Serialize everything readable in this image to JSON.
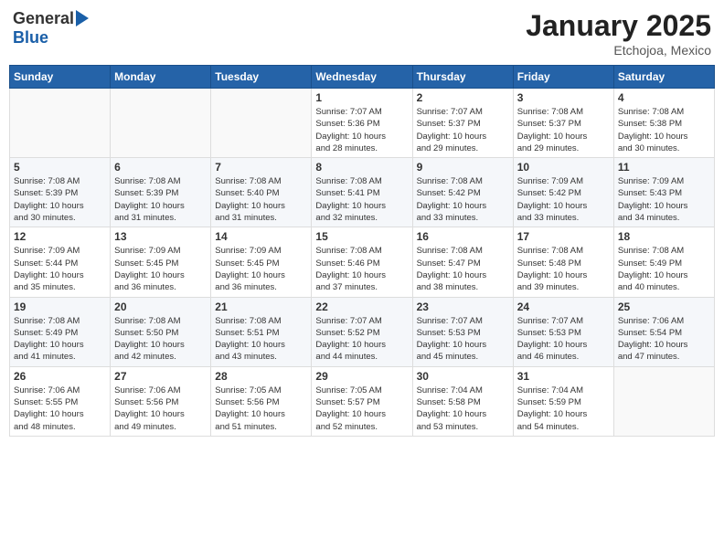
{
  "header": {
    "logo_general": "General",
    "logo_blue": "Blue",
    "title": "January 2025",
    "location": "Etchojoa, Mexico"
  },
  "days_of_week": [
    "Sunday",
    "Monday",
    "Tuesday",
    "Wednesday",
    "Thursday",
    "Friday",
    "Saturday"
  ],
  "weeks": [
    [
      {
        "day": "",
        "info": ""
      },
      {
        "day": "",
        "info": ""
      },
      {
        "day": "",
        "info": ""
      },
      {
        "day": "1",
        "info": "Sunrise: 7:07 AM\nSunset: 5:36 PM\nDaylight: 10 hours\nand 28 minutes."
      },
      {
        "day": "2",
        "info": "Sunrise: 7:07 AM\nSunset: 5:37 PM\nDaylight: 10 hours\nand 29 minutes."
      },
      {
        "day": "3",
        "info": "Sunrise: 7:08 AM\nSunset: 5:37 PM\nDaylight: 10 hours\nand 29 minutes."
      },
      {
        "day": "4",
        "info": "Sunrise: 7:08 AM\nSunset: 5:38 PM\nDaylight: 10 hours\nand 30 minutes."
      }
    ],
    [
      {
        "day": "5",
        "info": "Sunrise: 7:08 AM\nSunset: 5:39 PM\nDaylight: 10 hours\nand 30 minutes."
      },
      {
        "day": "6",
        "info": "Sunrise: 7:08 AM\nSunset: 5:39 PM\nDaylight: 10 hours\nand 31 minutes."
      },
      {
        "day": "7",
        "info": "Sunrise: 7:08 AM\nSunset: 5:40 PM\nDaylight: 10 hours\nand 31 minutes."
      },
      {
        "day": "8",
        "info": "Sunrise: 7:08 AM\nSunset: 5:41 PM\nDaylight: 10 hours\nand 32 minutes."
      },
      {
        "day": "9",
        "info": "Sunrise: 7:08 AM\nSunset: 5:42 PM\nDaylight: 10 hours\nand 33 minutes."
      },
      {
        "day": "10",
        "info": "Sunrise: 7:09 AM\nSunset: 5:42 PM\nDaylight: 10 hours\nand 33 minutes."
      },
      {
        "day": "11",
        "info": "Sunrise: 7:09 AM\nSunset: 5:43 PM\nDaylight: 10 hours\nand 34 minutes."
      }
    ],
    [
      {
        "day": "12",
        "info": "Sunrise: 7:09 AM\nSunset: 5:44 PM\nDaylight: 10 hours\nand 35 minutes."
      },
      {
        "day": "13",
        "info": "Sunrise: 7:09 AM\nSunset: 5:45 PM\nDaylight: 10 hours\nand 36 minutes."
      },
      {
        "day": "14",
        "info": "Sunrise: 7:09 AM\nSunset: 5:45 PM\nDaylight: 10 hours\nand 36 minutes."
      },
      {
        "day": "15",
        "info": "Sunrise: 7:08 AM\nSunset: 5:46 PM\nDaylight: 10 hours\nand 37 minutes."
      },
      {
        "day": "16",
        "info": "Sunrise: 7:08 AM\nSunset: 5:47 PM\nDaylight: 10 hours\nand 38 minutes."
      },
      {
        "day": "17",
        "info": "Sunrise: 7:08 AM\nSunset: 5:48 PM\nDaylight: 10 hours\nand 39 minutes."
      },
      {
        "day": "18",
        "info": "Sunrise: 7:08 AM\nSunset: 5:49 PM\nDaylight: 10 hours\nand 40 minutes."
      }
    ],
    [
      {
        "day": "19",
        "info": "Sunrise: 7:08 AM\nSunset: 5:49 PM\nDaylight: 10 hours\nand 41 minutes."
      },
      {
        "day": "20",
        "info": "Sunrise: 7:08 AM\nSunset: 5:50 PM\nDaylight: 10 hours\nand 42 minutes."
      },
      {
        "day": "21",
        "info": "Sunrise: 7:08 AM\nSunset: 5:51 PM\nDaylight: 10 hours\nand 43 minutes."
      },
      {
        "day": "22",
        "info": "Sunrise: 7:07 AM\nSunset: 5:52 PM\nDaylight: 10 hours\nand 44 minutes."
      },
      {
        "day": "23",
        "info": "Sunrise: 7:07 AM\nSunset: 5:53 PM\nDaylight: 10 hours\nand 45 minutes."
      },
      {
        "day": "24",
        "info": "Sunrise: 7:07 AM\nSunset: 5:53 PM\nDaylight: 10 hours\nand 46 minutes."
      },
      {
        "day": "25",
        "info": "Sunrise: 7:06 AM\nSunset: 5:54 PM\nDaylight: 10 hours\nand 47 minutes."
      }
    ],
    [
      {
        "day": "26",
        "info": "Sunrise: 7:06 AM\nSunset: 5:55 PM\nDaylight: 10 hours\nand 48 minutes."
      },
      {
        "day": "27",
        "info": "Sunrise: 7:06 AM\nSunset: 5:56 PM\nDaylight: 10 hours\nand 49 minutes."
      },
      {
        "day": "28",
        "info": "Sunrise: 7:05 AM\nSunset: 5:56 PM\nDaylight: 10 hours\nand 51 minutes."
      },
      {
        "day": "29",
        "info": "Sunrise: 7:05 AM\nSunset: 5:57 PM\nDaylight: 10 hours\nand 52 minutes."
      },
      {
        "day": "30",
        "info": "Sunrise: 7:04 AM\nSunset: 5:58 PM\nDaylight: 10 hours\nand 53 minutes."
      },
      {
        "day": "31",
        "info": "Sunrise: 7:04 AM\nSunset: 5:59 PM\nDaylight: 10 hours\nand 54 minutes."
      },
      {
        "day": "",
        "info": ""
      }
    ]
  ]
}
